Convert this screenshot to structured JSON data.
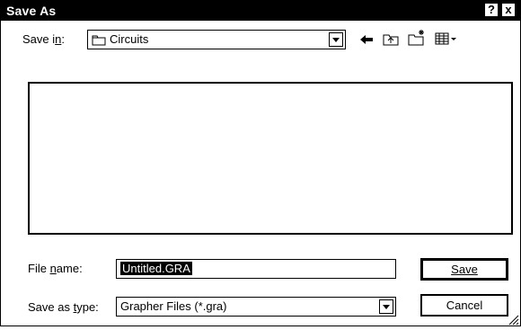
{
  "window": {
    "title": "Save As",
    "help_glyph": "?",
    "close_glyph": "x"
  },
  "toolbar": {
    "save_in_label": "Save in:",
    "folder_name": "Circuits",
    "icons": [
      "back-arrow-icon",
      "up-one-level-icon",
      "new-folder-icon",
      "view-menu-icon"
    ]
  },
  "form": {
    "file_name_label": "File name:",
    "file_name_value": "Untitled.GRA",
    "save_as_type_label": "Save as type:",
    "save_as_type_value": "Grapher Files (*.gra)"
  },
  "buttons": {
    "save": "Save",
    "cancel": "Cancel"
  }
}
